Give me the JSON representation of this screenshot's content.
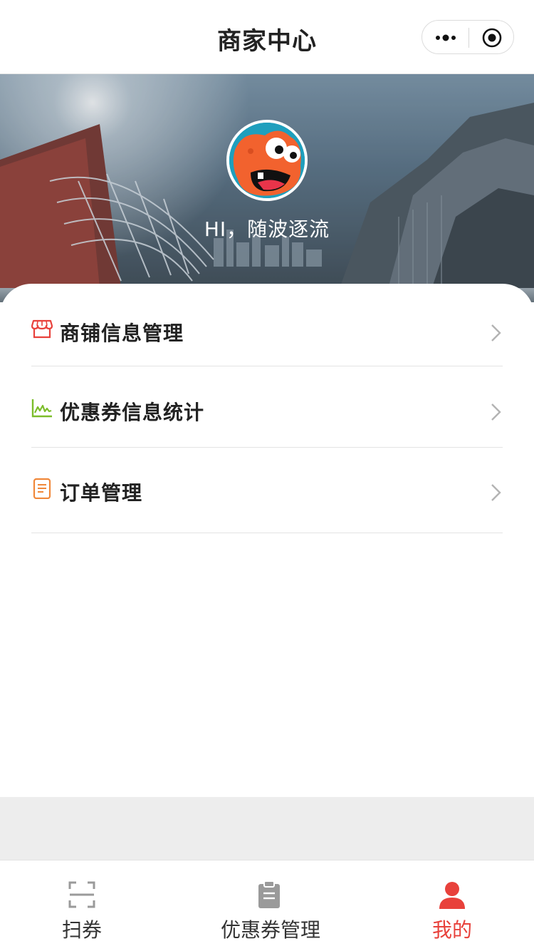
{
  "navbar": {
    "title": "商家中心",
    "more_icon": "more-dots-icon",
    "close_icon": "target-close-icon"
  },
  "profile": {
    "greeting": "HI，随波逐流",
    "avatar_icon": "orange-monster-avatar"
  },
  "menu": [
    {
      "label": "商铺信息管理",
      "icon": "store-icon",
      "icon_color": "#e8413b"
    },
    {
      "label": "优惠券信息统计",
      "icon": "chart-line-icon",
      "icon_color": "#7cbd2a"
    },
    {
      "label": "订单管理",
      "icon": "document-icon",
      "icon_color": "#f0883a"
    }
  ],
  "tabbar": {
    "tabs": [
      {
        "label": "扫券",
        "icon": "scan-icon",
        "active": false
      },
      {
        "label": "优惠券管理",
        "icon": "clipboard-icon",
        "active": false
      },
      {
        "label": "我的",
        "icon": "user-icon",
        "active": true
      }
    ],
    "active_color": "#e8413b",
    "inactive_color": "#9a9a9a"
  }
}
